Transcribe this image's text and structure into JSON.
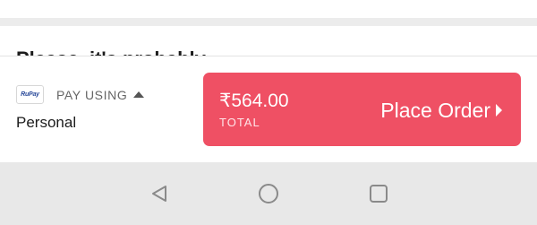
{
  "content": {
    "partial_heading": "Please, it's probably"
  },
  "payment": {
    "card_brand": "RuPay",
    "pay_using_label": "PAY USING",
    "method_name": "Personal"
  },
  "order_button": {
    "amount": "₹564.00",
    "total_label": "TOTAL",
    "label": "Place Order"
  },
  "navigation": {
    "buttons": [
      "back",
      "home",
      "recents"
    ]
  },
  "colors": {
    "accent": "#ef5064",
    "nav_bar": "#e8e8e8"
  }
}
